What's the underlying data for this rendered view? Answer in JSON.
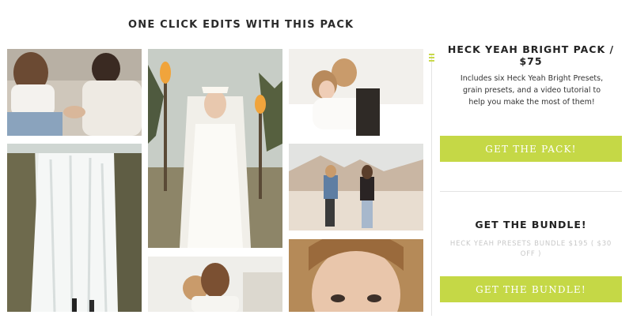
{
  "section": {
    "heading": "ONE CLICK EDITS WITH THIS PACK"
  },
  "gallery": {
    "photos": [
      {
        "name": "couple-holding-hands"
      },
      {
        "name": "waterfall-couple"
      },
      {
        "name": "bride-with-torches"
      },
      {
        "name": "couple-hugging-in-bed"
      },
      {
        "name": "couple-walking-beach"
      },
      {
        "name": "couple-kissing"
      },
      {
        "name": "woman-portrait"
      }
    ]
  },
  "pack": {
    "title": "HECK YEAH BRIGHT PACK / $75",
    "description": "Includes six Heck Yeah Bright Presets, grain presets, and a video tutorial to help you make the most of them!",
    "button_label": "GET THE PACK!"
  },
  "bundle": {
    "title": "GET THE BUNDLE!",
    "price_text": "HECK YEAH PRESETS BUNDLE $195 ( $30 OFF )",
    "button_label": "GET THE BUNDLE!"
  },
  "colors": {
    "accent": "#c5d846",
    "muted_text": "#c8c8c8",
    "divider": "#e3e3e3"
  }
}
